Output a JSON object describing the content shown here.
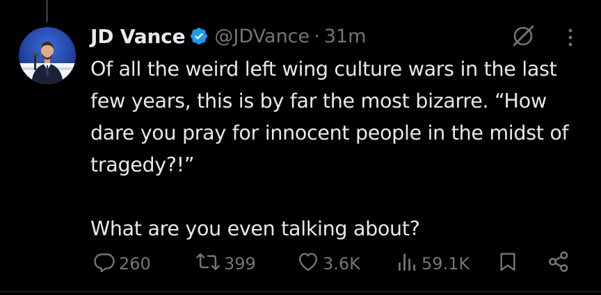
{
  "tweet": {
    "author": {
      "display_name": "JD Vance",
      "handle": "@JDVance",
      "verified": true
    },
    "separator": "·",
    "timestamp": "31m",
    "text": "Of all the weird left wing culture wars in the last few years, this is by far the most bizarre. “How dare you pray for innocent people in the midst of tragedy?!”\n\nWhat are you even talking about?"
  },
  "metrics": {
    "replies": "260",
    "reposts": "399",
    "likes": "3.6K",
    "views": "59.1K"
  },
  "icons": {
    "verified": "verified-badge-icon",
    "grok": "grok-icon",
    "more": "more-icon",
    "reply": "reply-icon",
    "repost": "repost-icon",
    "like": "like-icon",
    "views": "views-icon",
    "bookmark": "bookmark-icon",
    "share": "share-icon"
  },
  "colors": {
    "background": "#000000",
    "text_primary": "#e7e9ea",
    "text_secondary": "#71767b",
    "verified": "#1d9bf0"
  }
}
